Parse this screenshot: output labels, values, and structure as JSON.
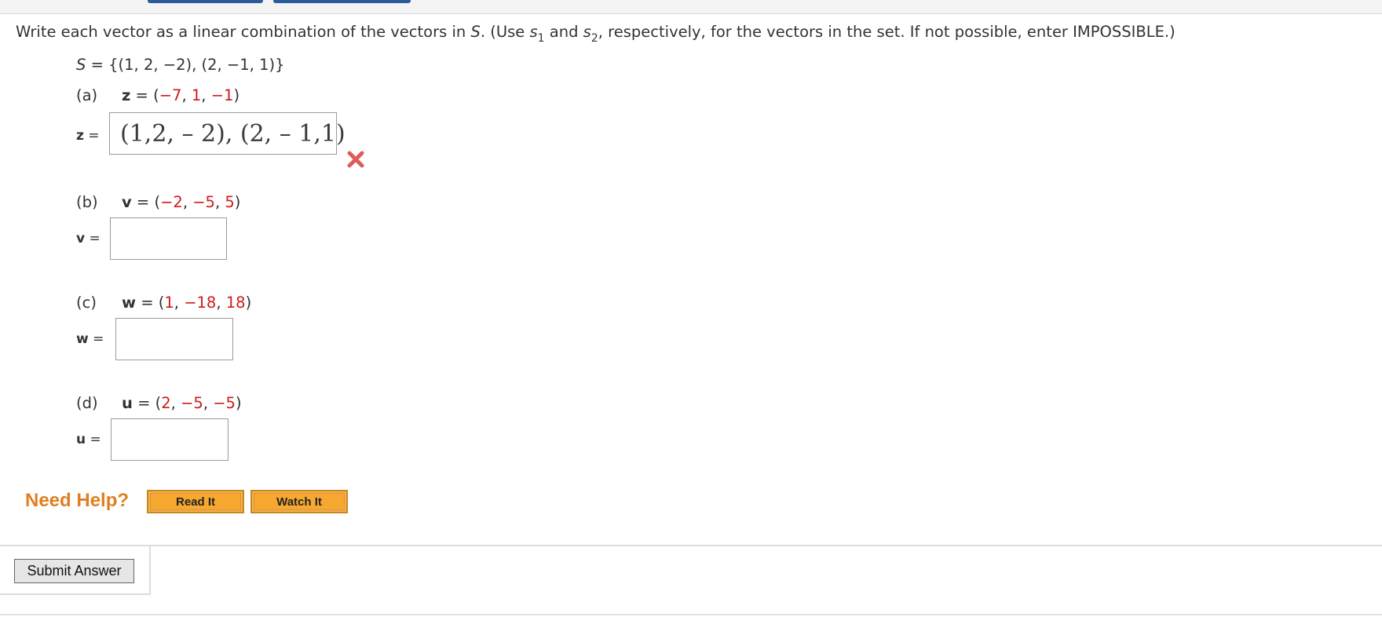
{
  "instructions": {
    "part1": "Write each vector as a linear combination of the vectors in ",
    "set_symbol": "S",
    "part2": ". (Use ",
    "s": "s",
    "sub1": "1",
    "part3": " and ",
    "sub2": "2",
    "part4": ", respectively, for the vectors in the set. If not possible, enter IMPOSSIBLE.)"
  },
  "set_definition": {
    "symbol": "S",
    "rest": " = {(1, 2, −2), (2, −1, 1)}"
  },
  "parts": [
    {
      "letter": "(a)",
      "var": "z",
      "open": " = (",
      "c1": "−7",
      "c2": "1",
      "c3": "−1",
      "close": ")",
      "answer_label": "z",
      "eq": " =",
      "answer_value": "(1,2, – 2), (2, – 1,1)",
      "status": "incorrect"
    },
    {
      "letter": "(b)",
      "var": "v",
      "open": " = (",
      "c1": "−2",
      "c2": "−5",
      "c3": "5",
      "close": ")",
      "answer_label": "v",
      "eq": " =",
      "answer_value": ""
    },
    {
      "letter": "(c)",
      "var": "w",
      "open": " = (",
      "c1": "1",
      "c2": "−18",
      "c3": "18",
      "close": ")",
      "answer_label": "w",
      "eq": " =",
      "answer_value": ""
    },
    {
      "letter": "(d)",
      "var": "u",
      "open": " = (",
      "c1": "2",
      "c2": "−5",
      "c3": "−5",
      "close": ")",
      "answer_label": "u",
      "eq": " =",
      "answer_value": ""
    }
  ],
  "sep": ", ",
  "help": {
    "title": "Need Help?",
    "read_it": "Read It",
    "watch_it": "Watch It"
  },
  "submit_label": "Submit Answer",
  "colors": {
    "accent_red": "#d0191a",
    "help_orange": "#e07f1f",
    "button_orange": "#f7a830",
    "tab_blue": "#2a5d9a",
    "incorrect_mark": "#e05a5a"
  },
  "icons": {
    "status_incorrect": "x-mark-icon"
  }
}
